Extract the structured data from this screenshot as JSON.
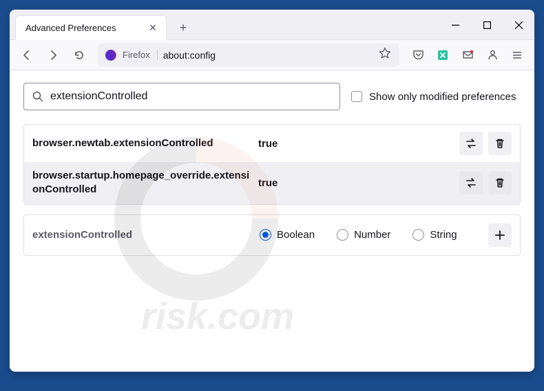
{
  "tab": {
    "title": "Advanced Preferences"
  },
  "url": {
    "identity": "Firefox",
    "value": "about:config"
  },
  "search": {
    "value": "extensionControlled"
  },
  "checkbox": {
    "label": "Show only modified preferences"
  },
  "prefs": [
    {
      "name": "browser.newtab.extensionControlled",
      "value": "true"
    },
    {
      "name": "browser.startup.homepage_override.extensionControlled",
      "value": "true"
    }
  ],
  "add": {
    "name": "extensionControlled",
    "types": {
      "boolean": "Boolean",
      "number": "Number",
      "string": "String"
    }
  }
}
